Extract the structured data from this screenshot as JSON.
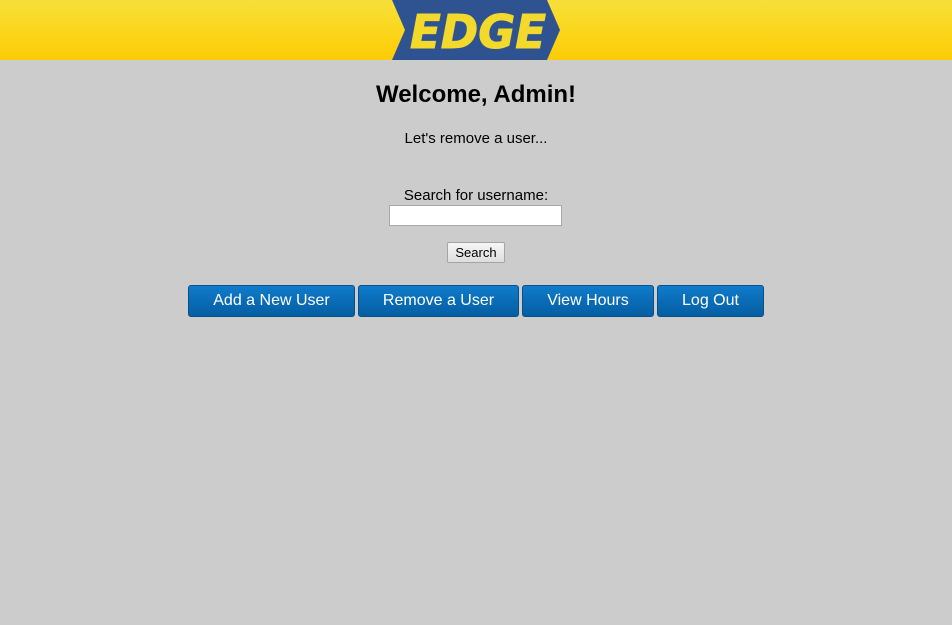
{
  "header": {
    "logo_text": "EDGE",
    "logo_colors": {
      "fill": "#f2d92c",
      "outline": "#2f5391"
    },
    "background_color": "#fbd61a"
  },
  "main": {
    "title": "Welcome, Admin!",
    "subtitle": "Let's remove a user...",
    "search": {
      "label": "Search for username:",
      "value": "",
      "placeholder": "",
      "button_label": "Search"
    }
  },
  "nav": {
    "buttons": [
      {
        "label": "Add a New User"
      },
      {
        "label": "Remove a User"
      },
      {
        "label": "View Hours"
      },
      {
        "label": "Log Out"
      }
    ],
    "button_color": "#0a6cb6"
  },
  "page": {
    "background_color": "#cccccc"
  }
}
